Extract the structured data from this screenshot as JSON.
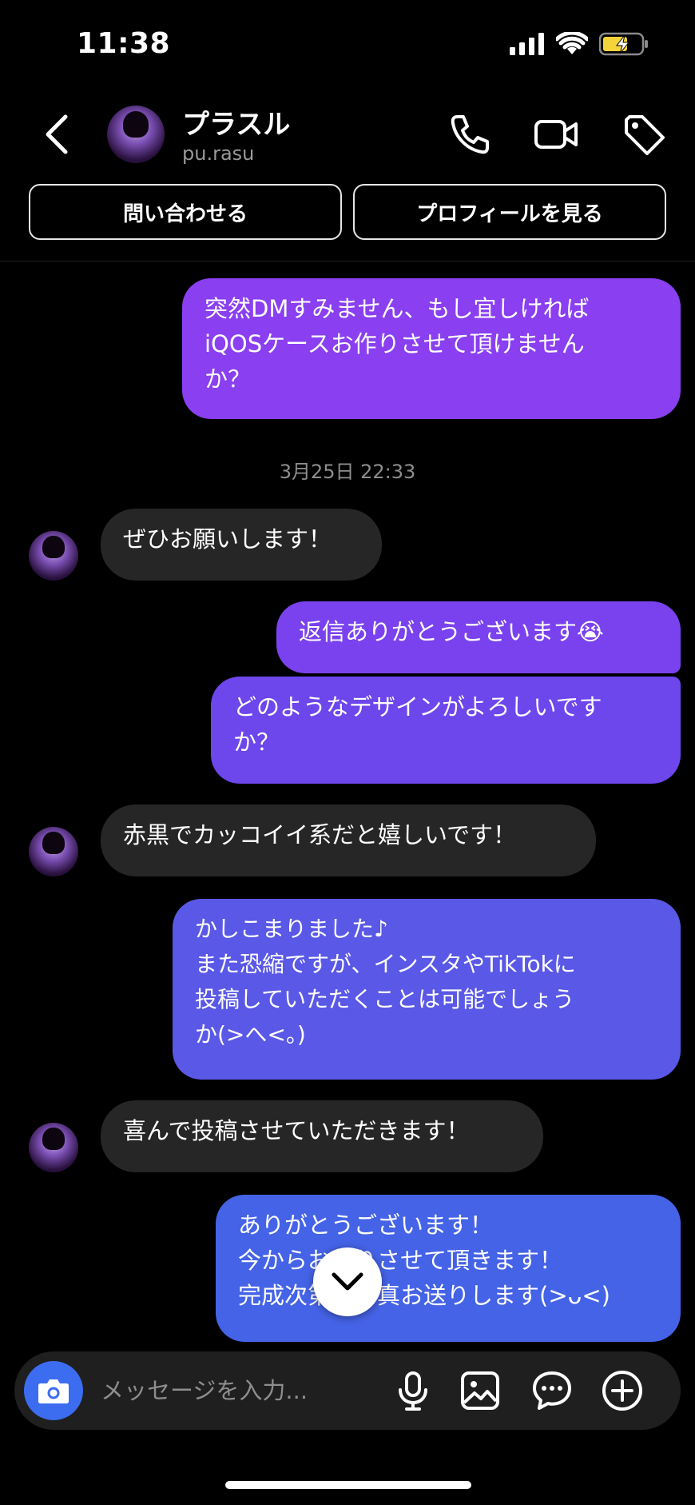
{
  "status_bar": {
    "time": "11:38"
  },
  "header": {
    "name": "プラスル",
    "username": "pu.rasu",
    "buttons": {
      "contact": "問い合わせる",
      "view_profile": "プロフィールを見る"
    }
  },
  "messages": [
    {
      "side": "sent",
      "text": "突然DMすみません、もし宜しければ\niQOSケースお作りさせて頂けません\nか？"
    },
    {
      "side": "recv",
      "text": "ぜひお願いします！"
    },
    {
      "side": "sent",
      "text": "返信ありがとうございます😭"
    },
    {
      "side": "sent",
      "text": "どのようなデザインがよろしいです\nか？"
    },
    {
      "side": "recv",
      "text": "赤黒でカッコイイ系だと嬉しいです！"
    },
    {
      "side": "sent",
      "text": "かしこまりました♪\nまた恐縮ですが、インスタやTikTokに\n投稿していただくことは可能でしょう\nか(>へ<。)"
    },
    {
      "side": "recv",
      "text": "喜んで投稿させていただきます！"
    },
    {
      "side": "sent",
      "text": "ありがとうございます！\n今からお作りさせて頂きます！\n完成次第お写真お送りします(>ᴗ<)"
    }
  ],
  "date_separator": "3月25日 22:33",
  "composer": {
    "placeholder": "メッセージを入力..."
  },
  "colors": {
    "bubble_top": "#8a3ff0",
    "bubble_bottom": "#3d6ce8",
    "received": "#262626",
    "camera": "#3c6df0"
  }
}
